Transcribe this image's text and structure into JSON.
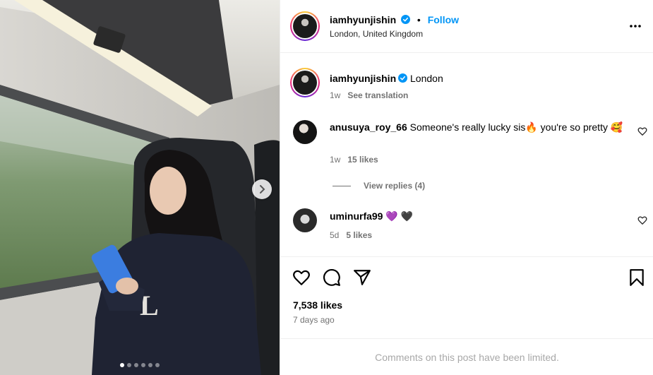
{
  "post": {
    "username": "iamhyunjishin",
    "follow_label": "Follow",
    "separator": "•",
    "location": "London, United Kingdom"
  },
  "caption": {
    "username": "iamhyunjishin",
    "text": "London",
    "time": "1w",
    "translation_label": "See translation"
  },
  "comments": [
    {
      "username": "anusuya_roy_66",
      "text": "Someone's really lucky sis🔥 you're so pretty 🥰",
      "time": "1w",
      "likes": "15 likes"
    },
    {
      "username": "uminurfa99",
      "text": "💜 🖤",
      "time": "5d",
      "likes": "5 likes"
    }
  ],
  "view_replies_label": "View replies (4)",
  "stats": {
    "likes": "7,538 likes",
    "posted": "7 days ago"
  },
  "footer": {
    "limited_text": "Comments on this post have been limited."
  },
  "icons": {
    "more": "more-horizontal-icon",
    "like": "heart-icon",
    "comment": "comment-bubble-icon",
    "share": "paper-plane-icon",
    "save": "bookmark-icon",
    "verified": "verified-badge-icon",
    "next": "chevron-right-icon"
  },
  "colors": {
    "accent": "#0095f6",
    "muted": "#737373",
    "limited": "#a8a8a8",
    "divider": "#efefef"
  },
  "carousel": {
    "total": 6,
    "active": 1
  }
}
